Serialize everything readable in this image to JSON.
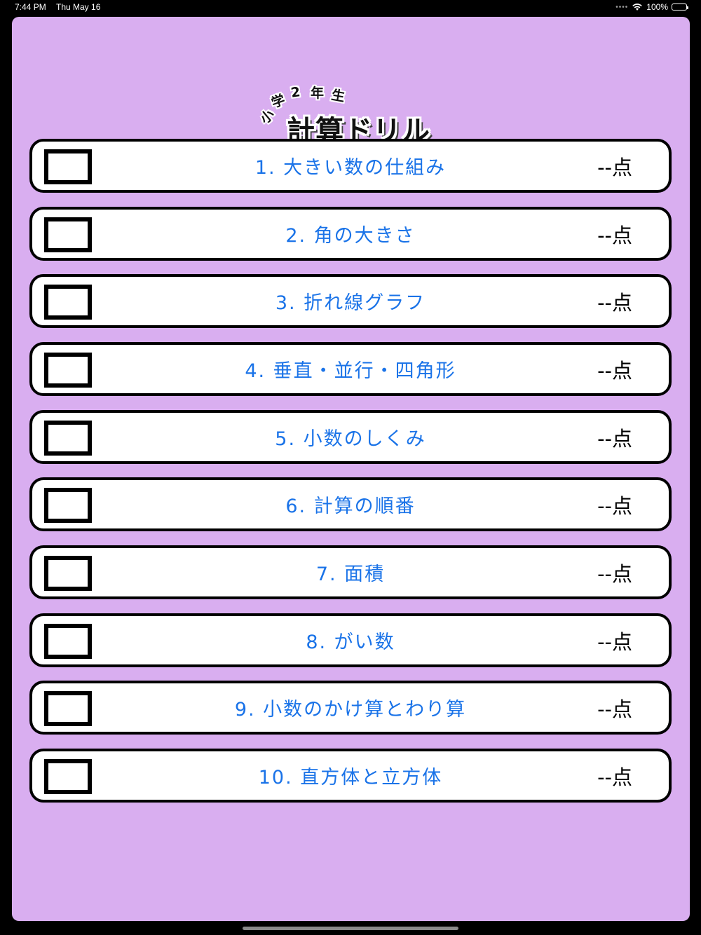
{
  "status_bar": {
    "time": "7:44 PM",
    "date": "Thu May 16",
    "battery": "100%",
    "battery_level": 1.0
  },
  "app": {
    "background_color": "#d9aef0",
    "logo": {
      "chars": [
        "小",
        "学",
        "2",
        "年",
        "生"
      ],
      "main": "計算ドリル"
    }
  },
  "lessons": [
    {
      "title": "1. 大きい数の仕組み",
      "score": "--点",
      "checked": false
    },
    {
      "title": "2. 角の大きさ",
      "score": "--点",
      "checked": false
    },
    {
      "title": "3. 折れ線グラフ",
      "score": "--点",
      "checked": false
    },
    {
      "title": "4. 垂直・並行・四角形",
      "score": "--点",
      "checked": false
    },
    {
      "title": "5. 小数のしくみ",
      "score": "--点",
      "checked": false
    },
    {
      "title": "6. 計算の順番",
      "score": "--点",
      "checked": false
    },
    {
      "title": "7. 面積",
      "score": "--点",
      "checked": false
    },
    {
      "title": "8. がい数",
      "score": "--点",
      "checked": false
    },
    {
      "title": "9. 小数のかけ算とわり算",
      "score": "--点",
      "checked": false
    },
    {
      "title": "10. 直方体と立方体",
      "score": "--点",
      "checked": false
    }
  ],
  "colors": {
    "title_text": "#1a73e8",
    "score_text": "#000000",
    "row_border": "#000000"
  }
}
